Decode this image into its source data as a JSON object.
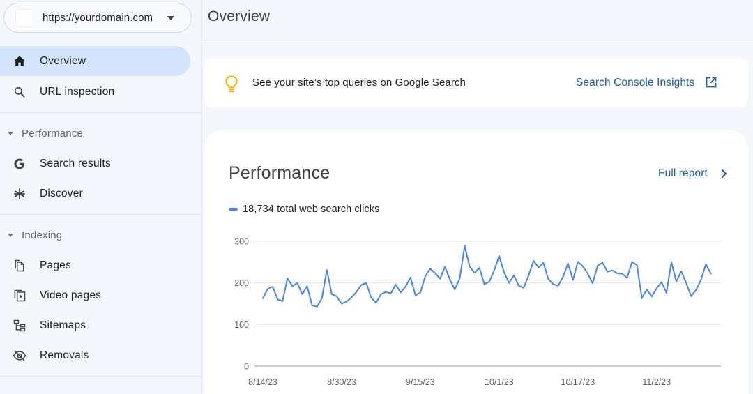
{
  "property": {
    "url": "https://yourdomain.com"
  },
  "sidebar": {
    "items": [
      {
        "label": "Overview",
        "icon": "home-icon",
        "active": true
      },
      {
        "label": "URL inspection",
        "icon": "search-icon",
        "active": false
      }
    ],
    "sections": [
      {
        "label": "Performance",
        "items": [
          {
            "label": "Search results",
            "icon": "google-g-icon"
          },
          {
            "label": "Discover",
            "icon": "asterisk-icon"
          }
        ]
      },
      {
        "label": "Indexing",
        "items": [
          {
            "label": "Pages",
            "icon": "pages-icon"
          },
          {
            "label": "Video pages",
            "icon": "video-pages-icon"
          },
          {
            "label": "Sitemaps",
            "icon": "sitemap-icon"
          },
          {
            "label": "Removals",
            "icon": "eye-off-icon"
          }
        ]
      }
    ]
  },
  "header": {
    "title": "Overview"
  },
  "insight": {
    "text": "See your site’s top queries on Google Search",
    "link_label": "Search Console Insights",
    "icon": "lightbulb-icon",
    "link_icon": "open-in-new-icon"
  },
  "performance": {
    "title": "Performance",
    "full_report_label": "Full report",
    "legend_label": "18,734 total web search clicks",
    "series_color": "#4285f4"
  },
  "chart_data": {
    "type": "line",
    "title": "",
    "xlabel": "",
    "ylabel": "",
    "ylim": [
      0,
      300
    ],
    "yticks": [
      0,
      100,
      200,
      300
    ],
    "xtick_labels": [
      "8/14/23",
      "8/30/23",
      "9/15/23",
      "10/1/23",
      "10/17/23",
      "11/2/23"
    ],
    "grid": true,
    "x": [
      "8/14/23",
      "8/15/23",
      "8/16/23",
      "8/17/23",
      "8/18/23",
      "8/19/23",
      "8/20/23",
      "8/21/23",
      "8/22/23",
      "8/23/23",
      "8/24/23",
      "8/25/23",
      "8/26/23",
      "8/27/23",
      "8/28/23",
      "8/29/23",
      "8/30/23",
      "8/31/23",
      "9/1/23",
      "9/2/23",
      "9/3/23",
      "9/4/23",
      "9/5/23",
      "9/6/23",
      "9/7/23",
      "9/8/23",
      "9/9/23",
      "9/10/23",
      "9/11/23",
      "9/12/23",
      "9/13/23",
      "9/14/23",
      "9/15/23",
      "9/16/23",
      "9/17/23",
      "9/18/23",
      "9/19/23",
      "9/20/23",
      "9/21/23",
      "9/22/23",
      "9/23/23",
      "9/24/23",
      "9/25/23",
      "9/26/23",
      "9/27/23",
      "9/28/23",
      "9/29/23",
      "9/30/23",
      "10/1/23",
      "10/2/23",
      "10/3/23",
      "10/4/23",
      "10/5/23",
      "10/6/23",
      "10/7/23",
      "10/8/23",
      "10/9/23",
      "10/10/23",
      "10/11/23",
      "10/12/23",
      "10/13/23",
      "10/14/23",
      "10/15/23",
      "10/16/23",
      "10/17/23",
      "10/18/23",
      "10/19/23",
      "10/20/23",
      "10/21/23",
      "10/22/23",
      "10/23/23",
      "10/24/23",
      "10/25/23",
      "10/26/23",
      "10/27/23",
      "10/28/23",
      "10/29/23",
      "10/30/23",
      "10/31/23",
      "11/1/23",
      "11/2/23",
      "11/3/23",
      "11/4/23",
      "11/5/23",
      "11/6/23",
      "11/7/23",
      "11/8/23",
      "11/9/23",
      "11/10/23",
      "11/11/23",
      "11/12/23"
    ],
    "series": [
      {
        "name": "",
        "color": "#4285f4",
        "values": [
          163,
          186,
          191,
          160,
          156,
          211,
          192,
          200,
          173,
          192,
          146,
          143,
          163,
          231,
          173,
          168,
          150,
          155,
          165,
          178,
          195,
          200,
          165,
          152,
          173,
          178,
          175,
          196,
          177,
          191,
          213,
          170,
          177,
          216,
          234,
          223,
          210,
          239,
          208,
          184,
          211,
          289,
          240,
          224,
          236,
          197,
          203,
          230,
          265,
          226,
          200,
          218,
          193,
          188,
          218,
          253,
          237,
          248,
          209,
          197,
          193,
          215,
          247,
          207,
          251,
          240,
          222,
          199,
          241,
          249,
          227,
          230,
          223,
          222,
          212,
          250,
          243,
          163,
          184,
          167,
          187,
          202,
          176,
          250,
          203,
          228,
          200,
          168,
          183,
          207,
          245,
          222
        ]
      }
    ]
  }
}
